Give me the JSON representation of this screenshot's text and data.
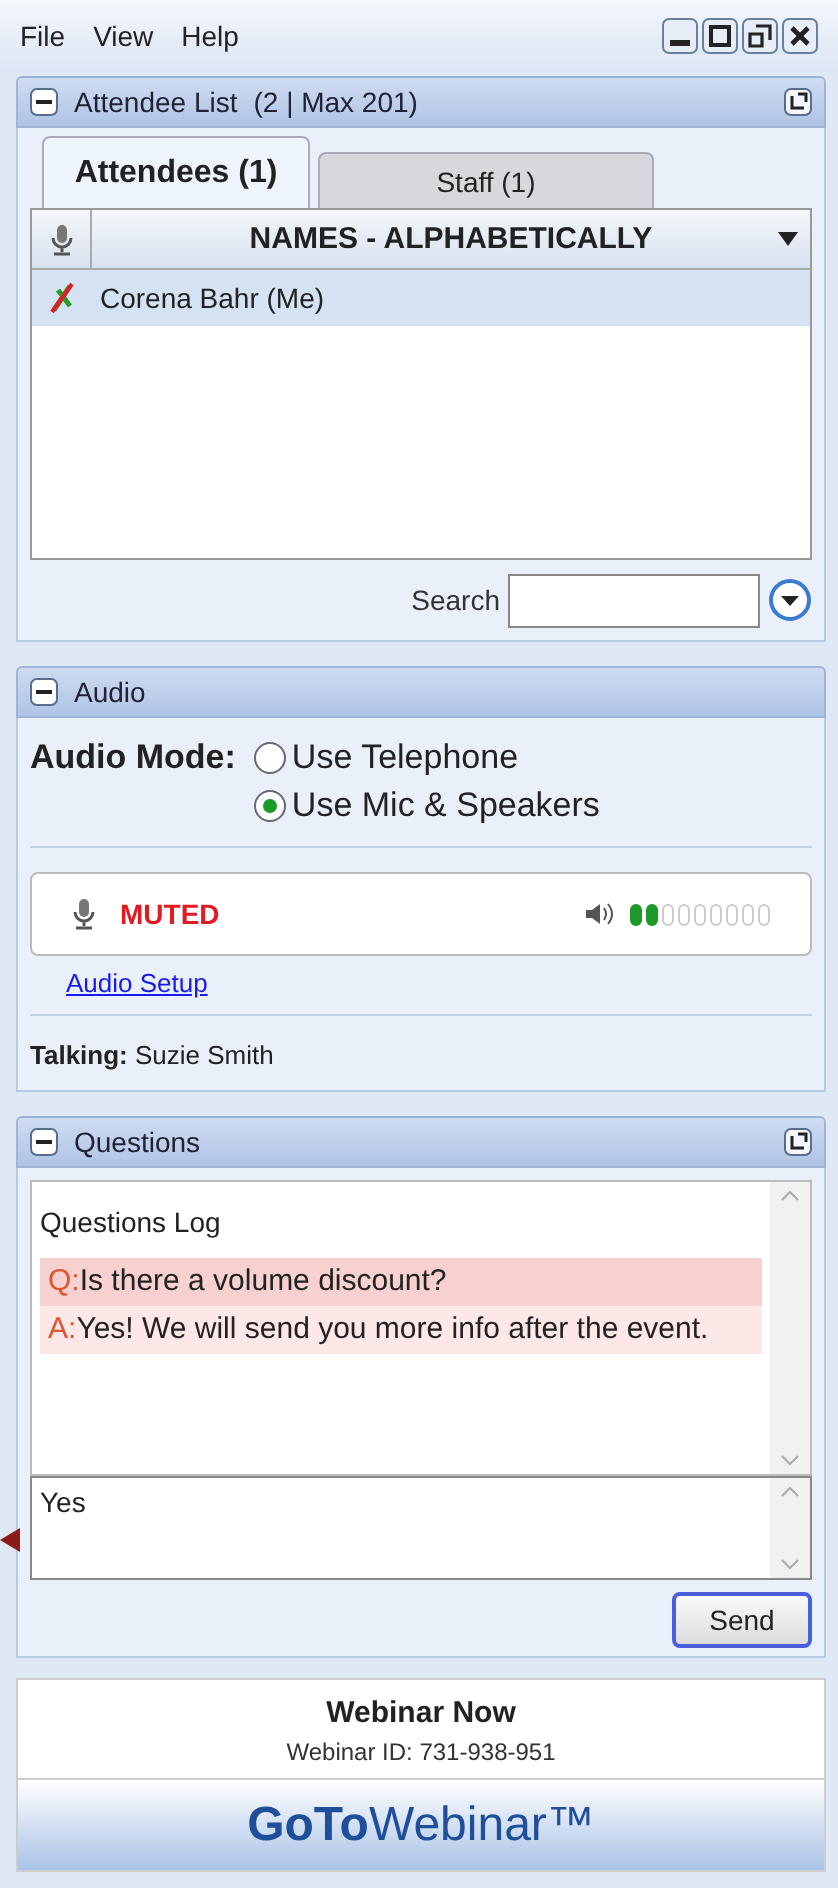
{
  "menu": [
    "File",
    "View",
    "Help"
  ],
  "attendee_panel": {
    "title": "Attendee List",
    "count": "(2 | Max 201)",
    "tabs": [
      {
        "label": "Attendees (1)",
        "selected": true
      },
      {
        "label": "Staff (1)",
        "selected": false
      }
    ],
    "column_header": "NAMES - ALPHABETICALLY",
    "rows": [
      {
        "name": "Corena Bahr (Me)",
        "selected": true,
        "muted": true
      }
    ],
    "search_label": "Search"
  },
  "audio_panel": {
    "title": "Audio",
    "mode_label": "Audio Mode:",
    "options": [
      {
        "label": "Use Telephone",
        "selected": false
      },
      {
        "label": "Use Mic & Speakers",
        "selected": true
      }
    ],
    "mic_status": "MUTED",
    "speaker_meter": {
      "level": 0.22
    },
    "setup_link": "Audio Setup",
    "talking": "**Talking:** Suzie Smith"
  },
  "questions_panel": {
    "title": "Questions",
    "log_title": "Questions Log",
    "entries": [
      {
        "kind": "question",
        "prefix": "Q:",
        "text": "Is there a volume discount?"
      },
      {
        "kind": "answer",
        "prefix": "A:",
        "text": "Yes! We will send you more info after the event."
      }
    ],
    "input_value": "Yes",
    "send_button": "Send"
  },
  "webinar": {
    "title": "Webinar Now",
    "id_line": "Webinar ID: 731-938-951",
    "brand": "**GoTo**Webinar™"
  }
}
